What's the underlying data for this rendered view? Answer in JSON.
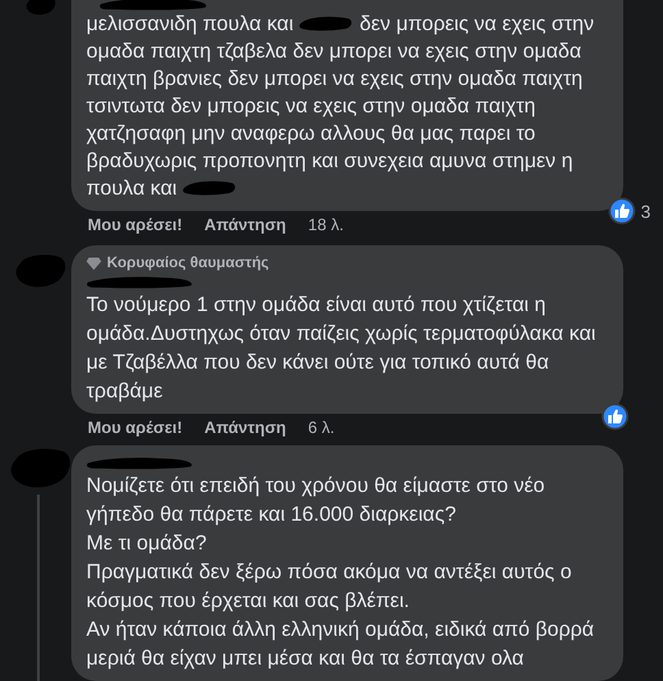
{
  "comments": [
    {
      "body": [
        {
          "kind": "text",
          "text": "μελισσανιδη πουλα και"
        },
        {
          "kind": "redaction"
        },
        {
          "kind": "text",
          "text": "δεν μπορεις να εχεις στην ομαδα παιχτη τζαβελα δεν μπορει να εχεις στην ομαδα παιχτη βρανιες δεν μπορει να εχεις στην ομαδα παιχτη τσιντωτα δεν μπορεις να εχεις στην ομαδα παιχτη χατζησαφη μην αναφερω αλλους θα μας παρει το βραδυχωρις προπονητη και συνεχεια αμυνα στημεν η πουλα και"
        },
        {
          "kind": "redaction"
        }
      ],
      "reaction": true,
      "reaction_count": "3",
      "actions": [
        "Μου αρέσει!",
        "Απάντηση"
      ],
      "time": "18 λ.",
      "reply_thread": false
    },
    {
      "top_fan_badge": "Κορυφαίος θαυμαστής",
      "body": [
        {
          "kind": "text",
          "text": "Το νούμερο 1 στην ομάδα είναι αυτό που χτίζεται η ομάδα.Δυστηχως όταν παίζεις χωρίς τερματοφύλακα και με Τζαβέλλα που δεν κάνει ούτε για τοπικό αυτά θα τραβάμε"
        }
      ],
      "reaction": true,
      "actions": [
        "Μου αρέσει!",
        "Απάντηση"
      ],
      "time": "6 λ.",
      "reply_thread": false
    },
    {
      "body": [
        {
          "kind": "text",
          "text": "Νομίζετε ότι επειδή του χρόνου θα είμαστε στο νέο γήπεδο θα πάρετε και 16.000 διαρκειας?\nΜε τι ομάδα?\nΠραγματικά δεν ξέρω πόσα ακόμα να αντέξει αυτός ο κόσμος που έρχεται και σας βλέπει.\nΑν ήταν κάποια άλλη ελληνική ομάδα, ειδικά από βορρά μεριά θα είχαν μπει μέσα και θα τα έσπαγαν ολα"
        }
      ],
      "reaction": false,
      "reply_thread": true
    }
  ]
}
